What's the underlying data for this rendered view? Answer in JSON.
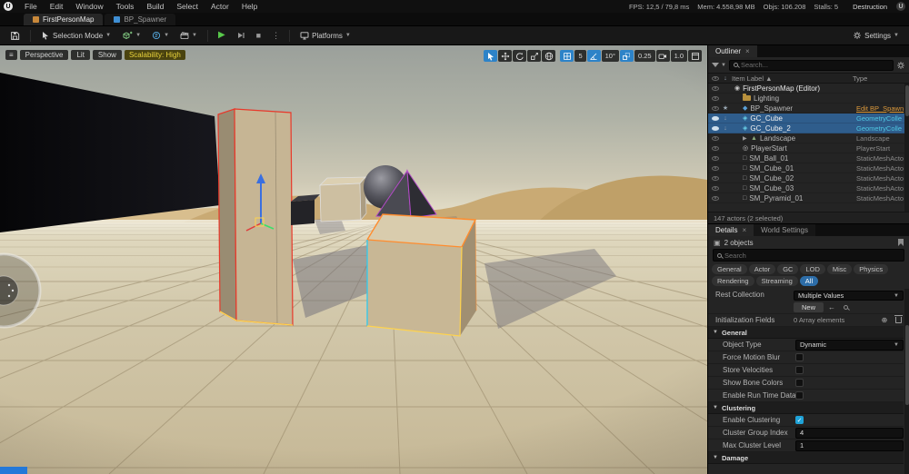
{
  "colors": {
    "accent_blue": "#2d83c8",
    "selection_row": "#2f5d8c",
    "type_orange": "#dd9a3c",
    "type_cyan": "#4fc6e0",
    "scalability_yellow": "#e8d23c",
    "play_green": "#58c84a"
  },
  "menu": {
    "items": [
      "File",
      "Edit",
      "Window",
      "Tools",
      "Build",
      "Select",
      "Actor",
      "Help"
    ]
  },
  "stats": {
    "fps": "FPS: 12,5 / 79,8 ms",
    "mem": "Mem: 4.558,98 MB",
    "objs": "Objs: 106.208",
    "stalls": "Stalls: 5",
    "project": "Destruction"
  },
  "tabs": {
    "level": "FirstPersonMap",
    "asset": "BP_Spawner"
  },
  "toolbar": {
    "selection_mode": "Selection Mode",
    "platforms": "Platforms",
    "settings": "Settings"
  },
  "viewport": {
    "camera": "Perspective",
    "view_mode": "Lit",
    "show": "Show",
    "scalability": "Scalability: High",
    "snaps": {
      "grid": "5",
      "rotation": "10°",
      "scale": "0.25",
      "camera_speed": "1.0"
    }
  },
  "outliner": {
    "tab": "Outliner",
    "search_placeholder": "Search...",
    "col_label": "Item Label",
    "col_sort": "▲",
    "col_type": "Type",
    "rows": [
      {
        "label": "FirstPersonMap (Editor)",
        "type": ""
      },
      {
        "label": "Lighting",
        "type": ""
      },
      {
        "label": "BP_Spawner",
        "type": "Edit BP_Spawn"
      },
      {
        "label": "GC_Cube",
        "type": "GeometryColle"
      },
      {
        "label": "GC_Cube_2",
        "type": "GeometryColle"
      },
      {
        "label": "Landscape",
        "type": "Landscape"
      },
      {
        "label": "PlayerStart",
        "type": "PlayerStart"
      },
      {
        "label": "SM_Ball_01",
        "type": "StaticMeshActo"
      },
      {
        "label": "SM_Cube_01",
        "type": "StaticMeshActo"
      },
      {
        "label": "SM_Cube_02",
        "type": "StaticMeshActo"
      },
      {
        "label": "SM_Cube_03",
        "type": "StaticMeshActo"
      },
      {
        "label": "SM_Pyramid_01",
        "type": "StaticMeshActo"
      }
    ],
    "footer": "147 actors (2 selected)"
  },
  "details": {
    "tab_details": "Details",
    "tab_world": "World Settings",
    "objects_label": "2 objects",
    "search_placeholder": "Search",
    "chips": [
      "General",
      "Actor",
      "GC",
      "LOD",
      "Misc",
      "Physics",
      "Rendering",
      "Streaming",
      "All"
    ],
    "rest_collection": {
      "label": "Rest Collection",
      "value": "Multiple Values",
      "new_button": "New"
    },
    "init_fields": {
      "label": "Initialization Fields",
      "value": "0 Array elements"
    },
    "section_general": "General",
    "section_clustering": "Clustering",
    "section_damage": "Damage",
    "object_type": {
      "label": "Object Type",
      "value": "Dynamic"
    },
    "force_motion_blur": {
      "label": "Force Motion Blur",
      "checked": false
    },
    "store_velocities": {
      "label": "Store Velocities",
      "checked": false
    },
    "show_bone_colors": {
      "label": "Show Bone Colors",
      "checked": false
    },
    "enable_runtime": {
      "label": "Enable Run Time Data Col...",
      "checked": false
    },
    "enable_clustering": {
      "label": "Enable Clustering",
      "checked": true
    },
    "cluster_group_index": {
      "label": "Cluster Group Index",
      "value": "4"
    },
    "max_cluster_level": {
      "label": "Max Cluster Level",
      "value": "1"
    }
  }
}
